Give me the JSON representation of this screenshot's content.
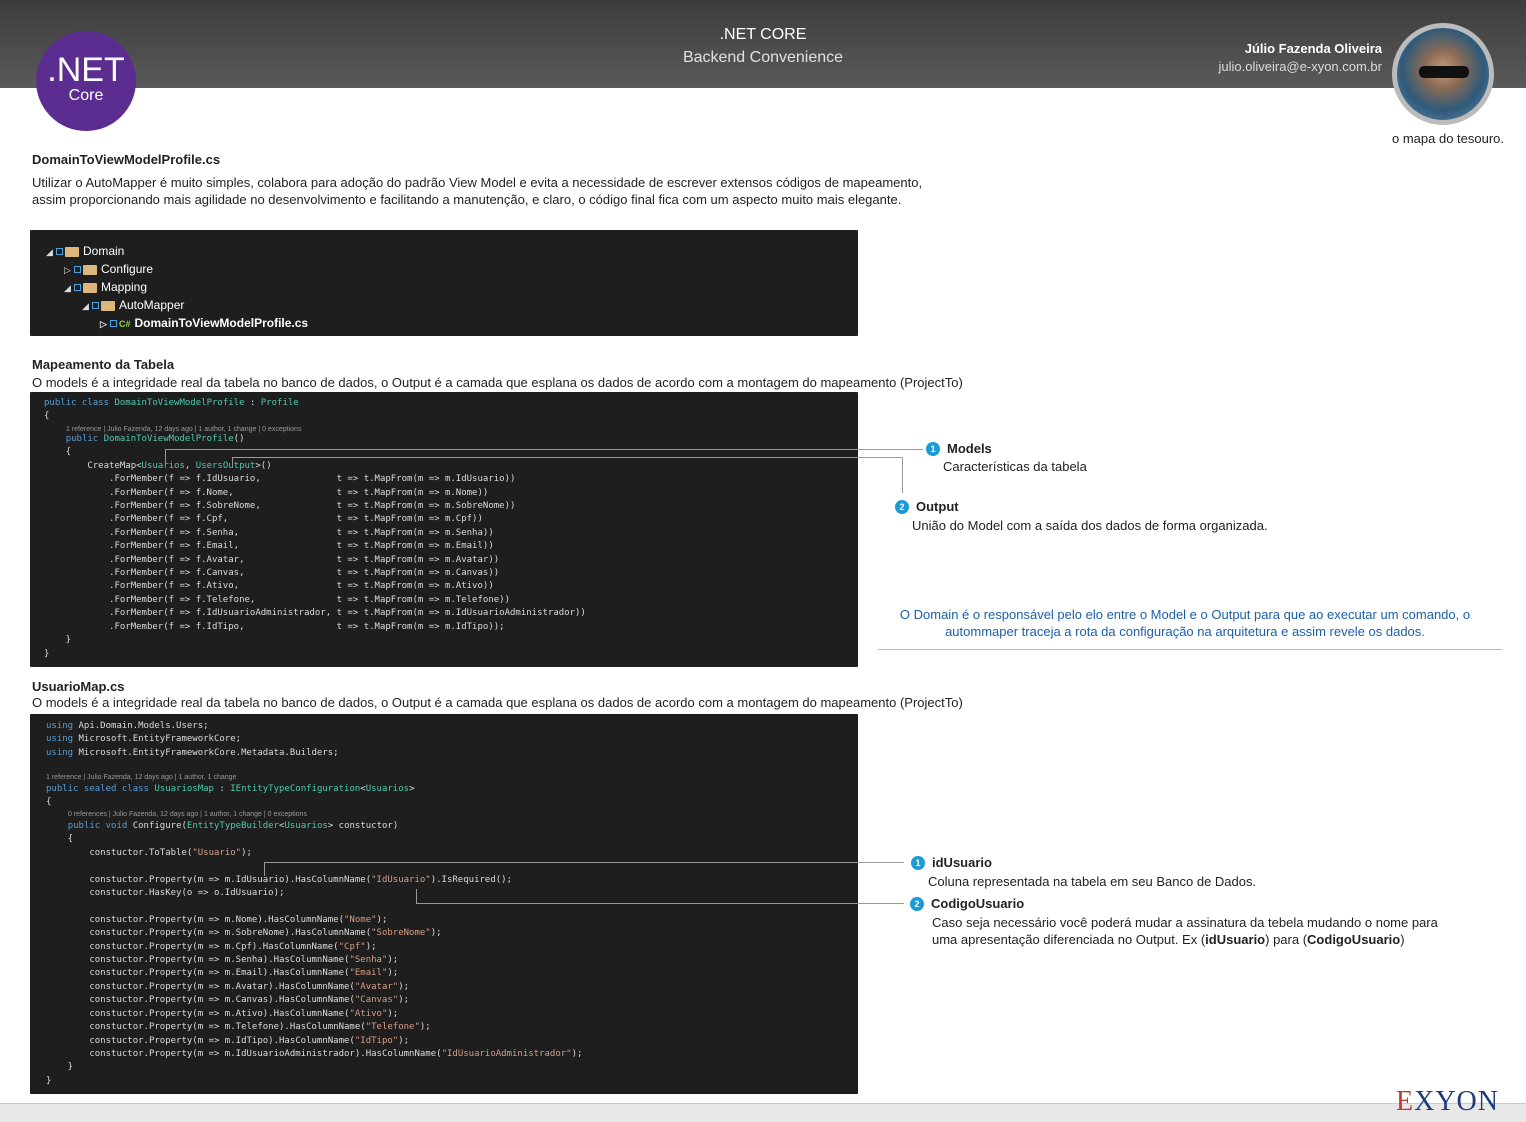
{
  "header": {
    "title": ".NET CORE",
    "subtitle": "Backend Convenience",
    "author_name": "Júlio Fazenda Oliveira",
    "author_email": "julio.oliveira@e-xyon.com.br",
    "logo_big": ".NET",
    "logo_small": "Core",
    "avatar_caption": "o mapa do tesouro."
  },
  "section1": {
    "title": "DomainToViewModelProfile.cs",
    "text": "Utilizar o AutoMapper é muito simples, colabora para adoção do padrão View Model e evita a necessidade de escrever extensos códigos de mapeamento, assim proporcionando mais agilidade no desenvolvimento e facilitando a manutenção, e claro, o código final fica com um aspecto muito mais elegante.",
    "tree": [
      "Domain",
      "Configure",
      "Mapping",
      "AutoMapper",
      "DomainToViewModelProfile.cs"
    ],
    "cs_badge": "C#"
  },
  "section2": {
    "title": "Mapeamento da Tabela",
    "text": "O models é a integridade real da tabela no banco de dados, o Output é a camada que esplana os dados de acordo com a montagem do mapeamento (ProjectTo)",
    "ref1": "1 reference | Julio Fazenda, 12 days ago | 1 author, 1 change | 0 exceptions"
  },
  "annotations1": [
    {
      "num": "1",
      "title": "Models",
      "desc": "Características da tabela"
    },
    {
      "num": "2",
      "title": "Output",
      "desc": "União do Model com a saída dos dados de forma organizada."
    }
  ],
  "blue_note": "O Domain é o responsável pelo elo entre o Model e o Output para que ao executar um comando, o autommaper traceja a rota da configuração na arquitetura e assim revele os dados.",
  "section3": {
    "title": "UsuarioMap.cs",
    "text": "O models é a integridade real da tabela no banco de dados, o Output é a camada que esplana os dados de acordo com a montagem do mapeamento (ProjectTo)",
    "ref1": "1 reference | Julio Fazenda, 12 days ago | 1 author, 1 change",
    "ref2": "0 references | Julio Fazenda, 12 days ago | 1 author, 1 change | 0 exceptions"
  },
  "annotations2": [
    {
      "num": "1",
      "title": "idUsuario",
      "desc": "Coluna representada na tabela em seu Banco de Dados."
    },
    {
      "num": "2",
      "title": "CodigoUsuario",
      "desc_line1": "Caso seja necessário você poderá mudar a assinatura da tebela mudando o nome para",
      "desc_pre": "uma apresentação diferenciada no Output. Ex (",
      "desc_b1": "idUsuario",
      "desc_mid": ") para (",
      "desc_b2": "CodigoUsuario",
      "desc_post": ")"
    }
  ],
  "brand": {
    "e": "E",
    "rest": "XYON"
  },
  "colors": {
    "header": "#4a4a4a",
    "dotnet": "#5c2d91",
    "badge": "#1a9ad6",
    "note": "#1c5fa8",
    "code_bg": "#1e1e1e"
  }
}
